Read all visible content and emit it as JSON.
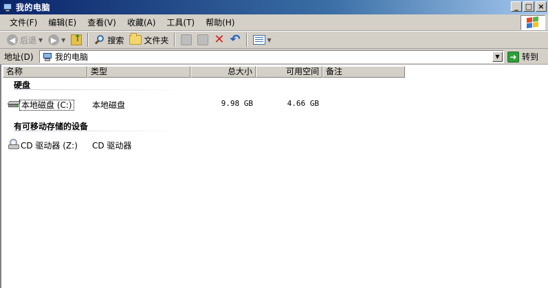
{
  "window": {
    "title": "我的电脑",
    "controls": [
      "_",
      "□",
      "×"
    ]
  },
  "menu": {
    "items": [
      "文件(F)",
      "编辑(E)",
      "查看(V)",
      "收藏(A)",
      "工具(T)",
      "帮助(H)"
    ]
  },
  "toolbar": {
    "back_label": "后退",
    "search_label": "搜索",
    "folders_label": "文件夹"
  },
  "address": {
    "label": "地址(D)",
    "value": "我的电脑",
    "go_label": "转到"
  },
  "columns": {
    "name": "名称",
    "type": "类型",
    "total": "总大小",
    "free": "可用空间",
    "comment": "备注"
  },
  "groups": [
    {
      "title": "硬盘",
      "items": [
        {
          "name": "本地磁盘 (C:)",
          "type": "本地磁盘",
          "total": "9.98 GB",
          "free": "4.66 GB",
          "icon": "hard-drive-icon"
        }
      ]
    },
    {
      "title": "有可移动存储的设备",
      "items": [
        {
          "name": "CD 驱动器 (Z:)",
          "type": "CD 驱动器",
          "total": "",
          "free": "",
          "icon": "cd-drive-icon"
        }
      ]
    }
  ]
}
